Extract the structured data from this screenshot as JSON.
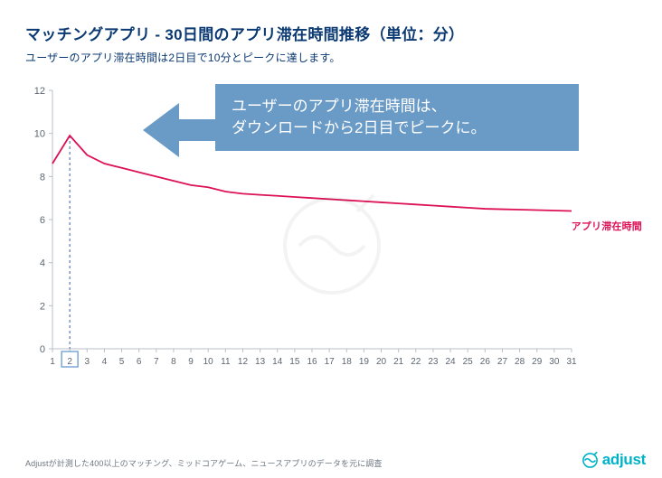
{
  "title": "マッチングアプリ - 30日間のアプリ滞在時間推移（単位：分）",
  "subtitle": "ユーザーのアプリ滞在時間は2日目で10分とピークに達します。",
  "callout_line1": "ユーザーのアプリ滞在時間は、",
  "callout_line2": "ダウンロードから2日目でピークに。",
  "series_label": "アプリ滞在時間",
  "footnote": "Adjustが計測した400以上のマッチング、ミッドコアゲーム、ニュースアプリのデータを元に調査",
  "brand_text": "adjust",
  "chart_data": {
    "type": "line",
    "title": "マッチングアプリ - 30日間のアプリ滞在時間推移（単位：分）",
    "xlabel": "",
    "ylabel": "",
    "ylim": [
      0,
      12
    ],
    "y_ticks": [
      0,
      2,
      4,
      6,
      8,
      10,
      12
    ],
    "x_ticks": [
      1,
      2,
      3,
      4,
      5,
      6,
      7,
      8,
      9,
      10,
      11,
      12,
      13,
      14,
      15,
      16,
      17,
      18,
      19,
      20,
      21,
      22,
      23,
      24,
      25,
      26,
      27,
      28,
      29,
      30,
      31
    ],
    "categories": [
      1,
      2,
      3,
      4,
      5,
      6,
      7,
      8,
      9,
      10,
      11,
      12,
      13,
      14,
      15,
      16,
      17,
      18,
      19,
      20,
      21,
      22,
      23,
      24,
      25,
      26,
      27,
      28,
      29,
      30,
      31
    ],
    "series": [
      {
        "name": "アプリ滞在時間",
        "color": "#dd1155",
        "values": [
          8.6,
          9.9,
          9.0,
          8.6,
          8.4,
          8.2,
          8.0,
          7.8,
          7.6,
          7.5,
          7.3,
          7.2,
          7.15,
          7.1,
          7.05,
          7.0,
          6.95,
          6.9,
          6.85,
          6.8,
          6.75,
          6.7,
          6.65,
          6.6,
          6.55,
          6.5,
          6.48,
          6.46,
          6.44,
          6.42,
          6.4
        ]
      }
    ],
    "highlight_x": 2,
    "legend_position": "right",
    "grid": false
  }
}
